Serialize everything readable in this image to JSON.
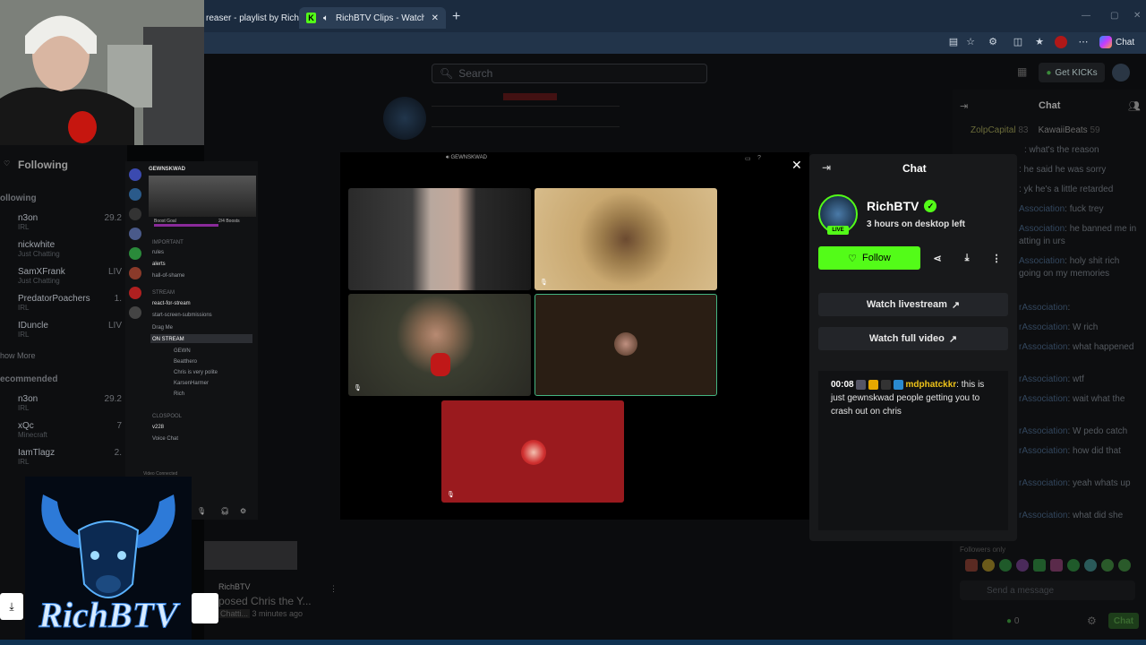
{
  "browser": {
    "tabs": [
      {
        "label": "reaser - playlist by Rich",
        "active": false
      },
      {
        "label": "RichBTV Clips - Watch Live on",
        "active": true
      }
    ],
    "toolbar": {
      "chat_label": "Chat"
    }
  },
  "site": {
    "search_placeholder": "Search",
    "kicks_label": "Get KICKs"
  },
  "background_chat": {
    "title": "Chat",
    "leaders": [
      {
        "name": "ZolpCapital",
        "count": "83"
      },
      {
        "name": "KawaiiBeats",
        "count": "59"
      }
    ],
    "lines": [
      {
        "user": "",
        "text": ": what's the reason"
      },
      {
        "user": "",
        "text": ": he said he was sorry"
      },
      {
        "user": "",
        "text": ": yk he's a little retarded"
      },
      {
        "user": "Association",
        "text": ": fuck trey"
      },
      {
        "user": "Association",
        "text": ": he banned me in"
      },
      {
        "user": "",
        "text": "atting in urs"
      },
      {
        "user": "Association",
        "text": ": holy shit rich"
      },
      {
        "user": "",
        "text": "going on my memories"
      },
      {
        "user": "rAssociation",
        "text": ":"
      },
      {
        "user": "rAssociation",
        "text": ": W rich"
      },
      {
        "user": "rAssociation",
        "text": ": what happened"
      },
      {
        "user": "rAssociation",
        "text": ": wtf"
      },
      {
        "user": "rAssociation",
        "text": ": wait what the"
      },
      {
        "user": "rAssociation",
        "text": ": W pedo catch"
      },
      {
        "user": "rAssociation",
        "text": ": how did that"
      },
      {
        "user": "rAssociation",
        "text": ": yeah whats up"
      },
      {
        "user": "rAssociation",
        "text": ": what did she"
      }
    ],
    "followers_only": "Followers only",
    "send_placeholder": "Send a message",
    "count": "0",
    "chat_button": "Chat"
  },
  "sidebar": {
    "following_title": "Following",
    "following_header": "ollowing",
    "following": [
      {
        "name": "n3on",
        "sub": "IRL",
        "count": "29.2"
      },
      {
        "name": "nickwhite",
        "sub": "Just Chatting",
        "count": ""
      },
      {
        "name": "SamXFrank",
        "sub": "Just Chatting",
        "count": "LIV"
      },
      {
        "name": "PredatorPoachers",
        "sub": "IRL",
        "count": "1."
      },
      {
        "name": "IDuncle",
        "sub": "IRL",
        "count": "LIV"
      }
    ],
    "show_more": "how More",
    "recommended_header": "ecommended",
    "recommended": [
      {
        "name": "n3on",
        "sub": "IRL",
        "count": "29.2"
      },
      {
        "name": "xQc",
        "sub": "Minecraft",
        "count": "7"
      },
      {
        "name": "IamTlagz",
        "sub": "IRL",
        "count": "2."
      }
    ]
  },
  "discord": {
    "server": "GEWNSKWAD",
    "boost_goal": "Boost Goal",
    "boost_count": "2/4 Boosts",
    "sections": [
      {
        "header": "IMPORTANT",
        "channels": [
          "rules",
          "alerts",
          "hall-of-shame"
        ]
      },
      {
        "header": "STREAM",
        "channels": [
          "react-for-stream",
          "start-screen-submissions",
          "Drag Me",
          "ON STREAM"
        ]
      },
      {
        "header": "CLOSPOOL",
        "channels": [
          "v228",
          "Voice Chat"
        ]
      }
    ],
    "voice_members": [
      "GEWN",
      "Beatthero",
      "Chris is very polite",
      "KarsenHarmer",
      "Rich"
    ],
    "voice_connected": "Video Connected"
  },
  "call": {
    "title": "GEWNSKWAD"
  },
  "chat_popup": {
    "title": "Chat",
    "channel_name": "RichBTV",
    "live_badge": "LIVE",
    "status": "3 hours on desktop left",
    "follow_label": "Follow",
    "watch_livestream": "Watch livestream",
    "watch_full_video": "Watch full video",
    "message": {
      "time": "00:08",
      "user": "mdphatckkr",
      "text": ": this is just gewnskwad people getting you to crash out on chris"
    }
  },
  "clip_meta": {
    "channel": "RichBTV",
    "title": "posed Chris the Y...",
    "category": "Chatti...",
    "time": "3 minutes ago"
  },
  "colors": {
    "accent": "#53fc18",
    "tab_bar": "#1b2b3f",
    "chat_bg": "#18191b"
  }
}
